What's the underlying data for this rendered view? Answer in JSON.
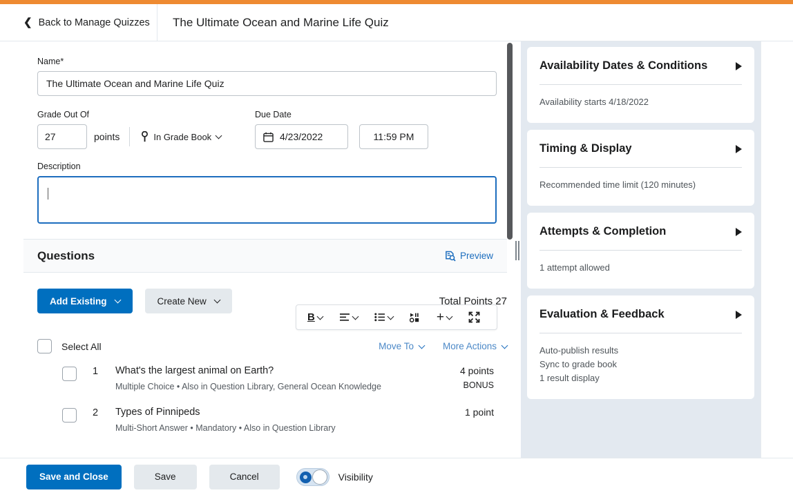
{
  "theme": {
    "orange": "#EE8A31",
    "primary_blue": "#006FBF",
    "link_blue": "#1C6DBE",
    "panel_bg": "#E3E9F0"
  },
  "header": {
    "back_label": "Back to Manage Quizzes",
    "back_icon": "chevron-left-icon",
    "title": "The Ultimate Ocean and Marine Life Quiz"
  },
  "form": {
    "name_label": "Name",
    "name_required_mark": "*",
    "name_value": "The Ultimate Ocean and Marine Life Quiz",
    "name_placeholder": "Name",
    "grade_label": "Grade Out Of",
    "grade_value": "27",
    "points_word": "points",
    "gradebook_label": "In Grade Book",
    "gradebook_icon": "key-icon",
    "gradebook_chevron": "chevron-down-icon",
    "due_label": "Due Date",
    "due_date_value": "4/23/2022",
    "due_date_icon": "calendar-icon",
    "due_time_value": "11:59 PM",
    "description_label": "Description",
    "description_value": ""
  },
  "editor_toolbar": {
    "items": [
      {
        "name": "bold-icon",
        "glyph": "B",
        "has_chevron": true
      },
      {
        "name": "align-left-icon",
        "glyph": "≡",
        "has_chevron": true
      },
      {
        "name": "bulleted-list-icon",
        "glyph": "☰",
        "has_chevron": true
      },
      {
        "name": "insert-media-icon",
        "glyph": "▶",
        "has_chevron": false
      },
      {
        "name": "plus-icon",
        "glyph": "+",
        "has_chevron": true
      },
      {
        "name": "fullscreen-icon",
        "glyph": "⤢",
        "has_chevron": false
      }
    ]
  },
  "questions": {
    "section_title": "Questions",
    "preview_label": "Preview",
    "preview_icon": "document-search-icon",
    "add_existing_label": "Add Existing",
    "create_new_label": "Create New",
    "total_points_label": "Total Points 27",
    "select_all_label": "Select All",
    "move_to_label": "Move To",
    "more_actions_label": "More Actions",
    "items": [
      {
        "number": "1",
        "title": "What's the largest animal on Earth?",
        "meta": "Multiple Choice  •  Also in Question Library, General Ocean Knowledge",
        "points": "4 points",
        "badge": "BONUS"
      },
      {
        "number": "2",
        "title": "Types of Pinnipeds",
        "meta": "Multi-Short Answer  •  Mandatory  •  Also in Question Library",
        "points": "1 point",
        "badge": ""
      }
    ]
  },
  "sidebar": {
    "panels": [
      {
        "title": "Availability Dates & Conditions",
        "arrow_icon": "triangle-right-icon",
        "lines": [
          "Availability starts 4/18/2022"
        ]
      },
      {
        "title": "Timing & Display",
        "arrow_icon": "triangle-right-icon",
        "lines": [
          "Recommended time limit (120 minutes)"
        ]
      },
      {
        "title": "Attempts & Completion",
        "arrow_icon": "triangle-right-icon",
        "lines": [
          "1 attempt allowed"
        ]
      },
      {
        "title": "Evaluation & Feedback",
        "arrow_icon": "triangle-right-icon",
        "lines": [
          "Auto-publish results",
          "Sync to grade book",
          "1 result display"
        ]
      }
    ]
  },
  "footer": {
    "save_and_close_label": "Save and Close",
    "save_label": "Save",
    "cancel_label": "Cancel",
    "visibility_label": "Visibility",
    "visibility_icon": "eye-icon"
  }
}
